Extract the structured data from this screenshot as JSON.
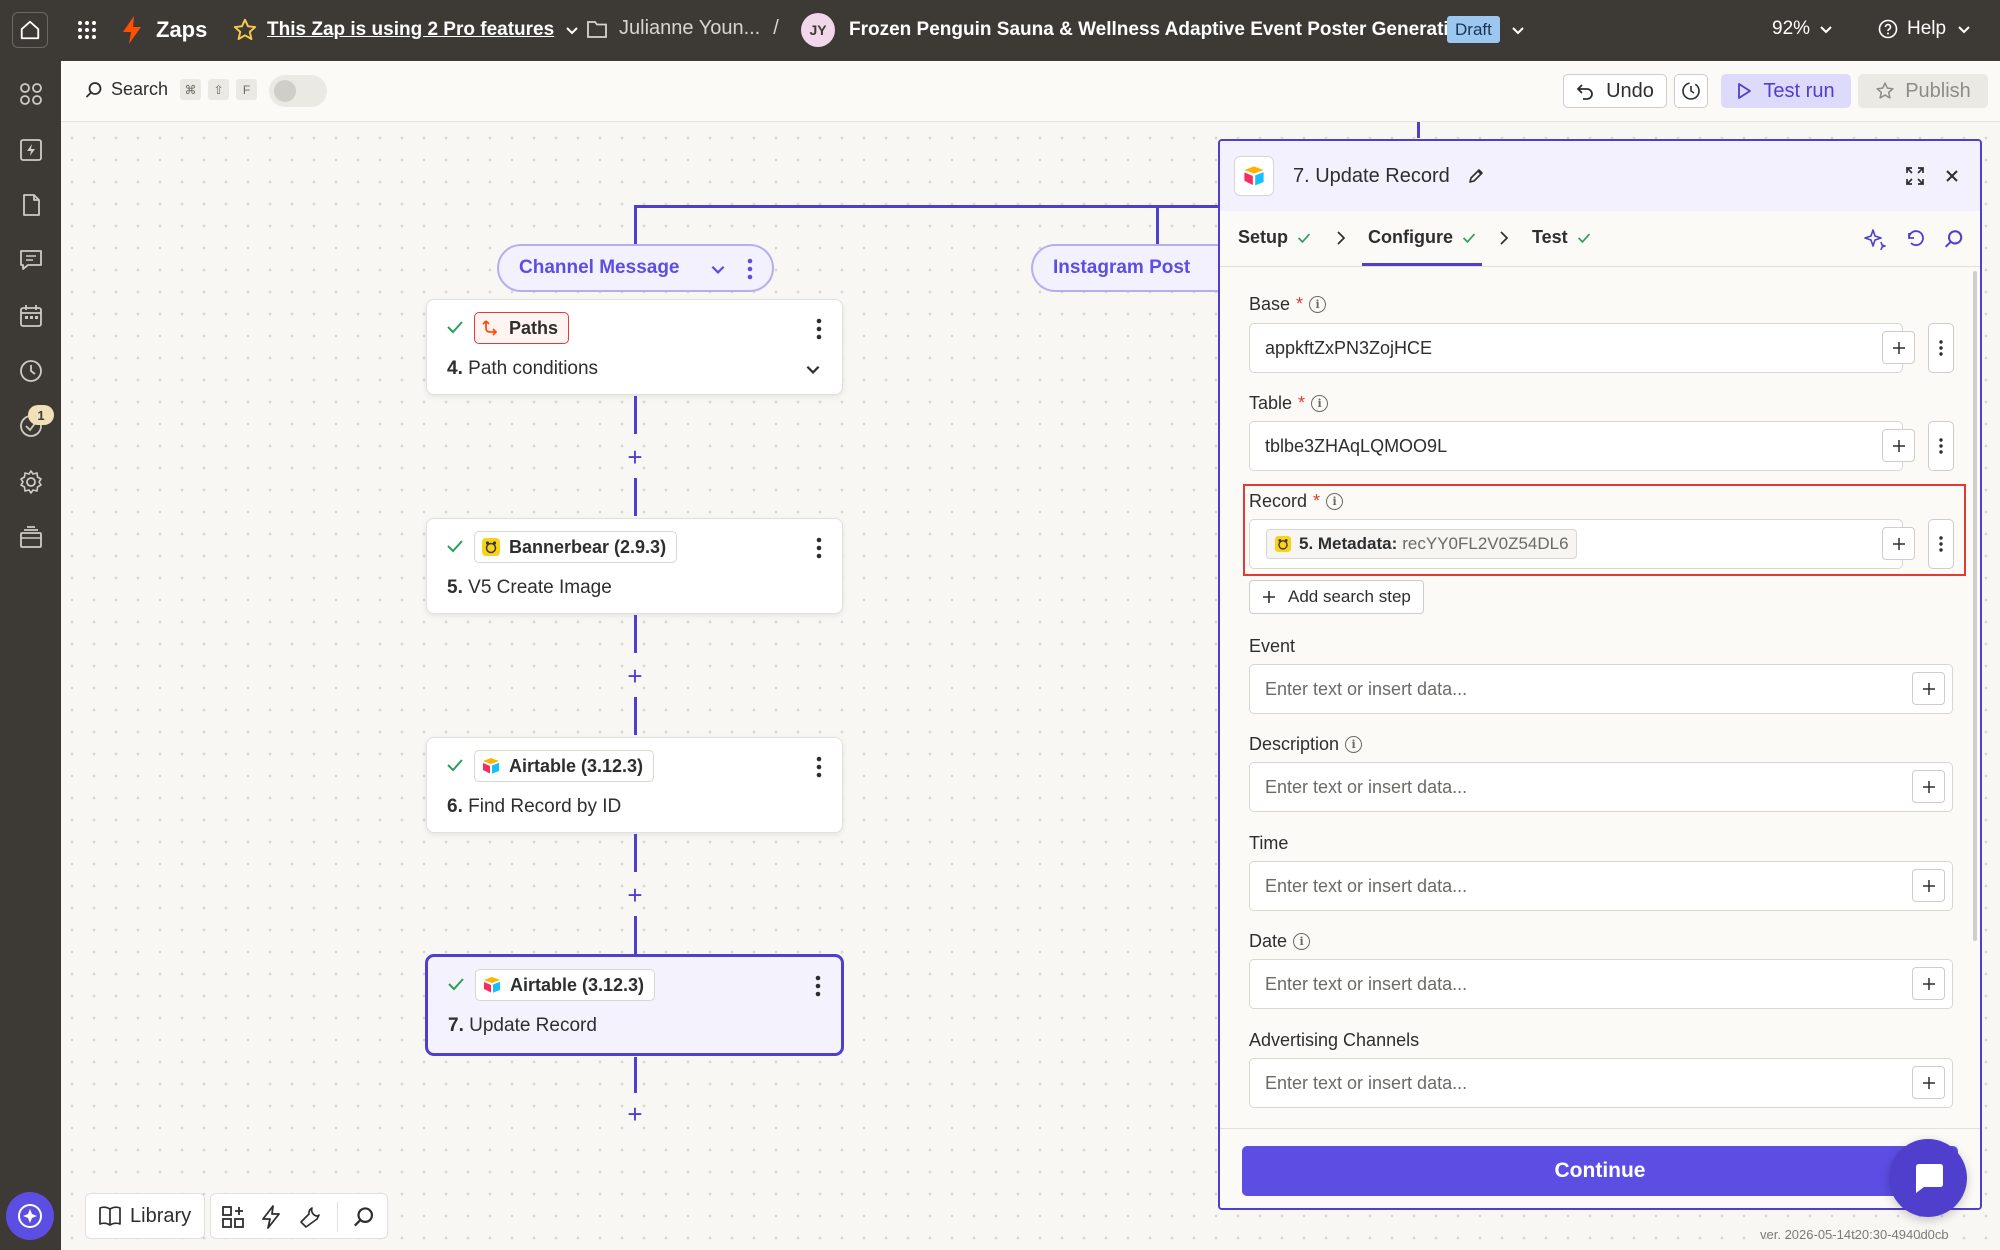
{
  "topbar": {
    "app_name": "Zaps",
    "pro_features": "This Zap is using 2 Pro features",
    "folder": "Julianne Youn...",
    "separator": "/",
    "avatar_initials": "JY",
    "zap_title": "Frozen Penguin Sauna & Wellness Adaptive Event Poster Generation",
    "status_badge": "Draft",
    "zoom": "92%",
    "help": "Help"
  },
  "sidebar": {
    "notification_count": "1",
    "icons": [
      "apps-icon",
      "zap-icon",
      "document-icon",
      "chat-icon",
      "calendar-icon",
      "history-icon",
      "checklist-icon",
      "settings-icon",
      "layers-icon",
      "assistant-icon"
    ]
  },
  "toolbar": {
    "search_label": "Search",
    "shortcut_keys": [
      "⌘",
      "⇧",
      "F"
    ],
    "undo_label": "Undo",
    "test_run_label": "Test run",
    "publish_label": "Publish"
  },
  "canvas": {
    "path_pills": [
      "Channel Message",
      "Instagram Post"
    ],
    "steps": [
      {
        "app": "Paths",
        "number": "4.",
        "title": "Path conditions"
      },
      {
        "app": "Bannerbear (2.9.3)",
        "number": "5.",
        "title": "V5 Create Image"
      },
      {
        "app": "Airtable (3.12.3)",
        "number": "6.",
        "title": "Find Record by ID"
      },
      {
        "app": "Airtable (3.12.3)",
        "number": "7.",
        "title": "Update Record"
      }
    ],
    "add_step": "+"
  },
  "bottom": {
    "library_label": "Library",
    "version": "ver. 2026-05-14t20:30-4940d0cb"
  },
  "panel": {
    "title": "7. Update Record",
    "tabs": [
      "Setup",
      "Configure",
      "Test"
    ],
    "fields": {
      "base": {
        "label": "Base",
        "value": "appkftZxPN3ZojHCE"
      },
      "table": {
        "label": "Table",
        "value": "tblbe3ZHAqLQMOO9L"
      },
      "record": {
        "label": "Record",
        "chip_step": "5. Metadata:",
        "chip_value": "recYY0FL2V0Z54DL6"
      },
      "add_search_step": "Add search step",
      "event": {
        "label": "Event"
      },
      "description": {
        "label": "Description"
      },
      "time": {
        "label": "Time"
      },
      "date": {
        "label": "Date"
      },
      "advertising": {
        "label": "Advertising Channels"
      }
    },
    "placeholder": "Enter text or insert data...",
    "required_mark": "*",
    "info_mark": "i",
    "continue_label": "Continue"
  },
  "colors": {
    "brand_orange": "#ff4f00",
    "accent_purple": "#4f3fcc",
    "highlight_red": "#e23b34",
    "topbar_bg": "#3d3a36",
    "draft_badge": "#9cc7f0"
  }
}
